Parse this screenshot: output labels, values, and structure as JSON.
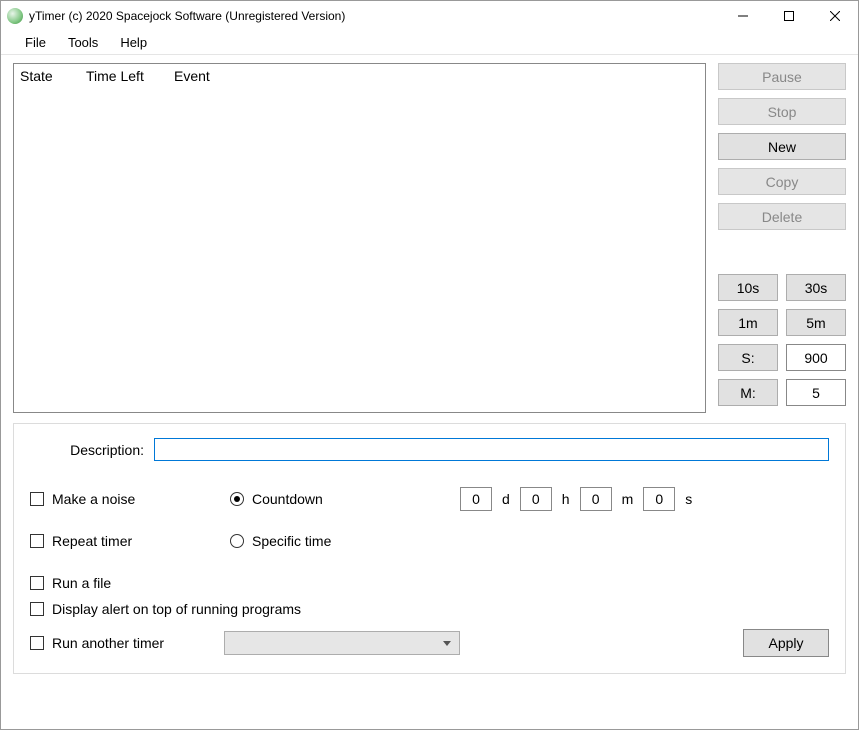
{
  "window": {
    "title": "yTimer (c) 2020 Spacejock Software (Unregistered Version)"
  },
  "menu": {
    "file": "File",
    "tools": "Tools",
    "help": "Help"
  },
  "columns": {
    "state": "State",
    "time_left": "Time Left",
    "event": "Event"
  },
  "buttons": {
    "pause": "Pause",
    "stop": "Stop",
    "new": "New",
    "copy": "Copy",
    "delete": "Delete",
    "apply": "Apply"
  },
  "quick": {
    "ten_s": "10s",
    "thirty_s": "30s",
    "one_m": "1m",
    "five_m": "5m",
    "s_label": "S:",
    "s_value": "900",
    "m_label": "M:",
    "m_value": "5"
  },
  "form": {
    "description_label": "Description:",
    "description_value": "",
    "make_noise": "Make a noise",
    "repeat_timer": "Repeat timer",
    "countdown": "Countdown",
    "specific_time": "Specific time",
    "run_a_file": "Run a file",
    "display_alert": "Display alert on top of running programs",
    "run_another": "Run another timer",
    "d": "d",
    "h": "h",
    "m": "m",
    "s": "s",
    "val_d": "0",
    "val_h": "0",
    "val_m": "0",
    "val_s": "0"
  }
}
